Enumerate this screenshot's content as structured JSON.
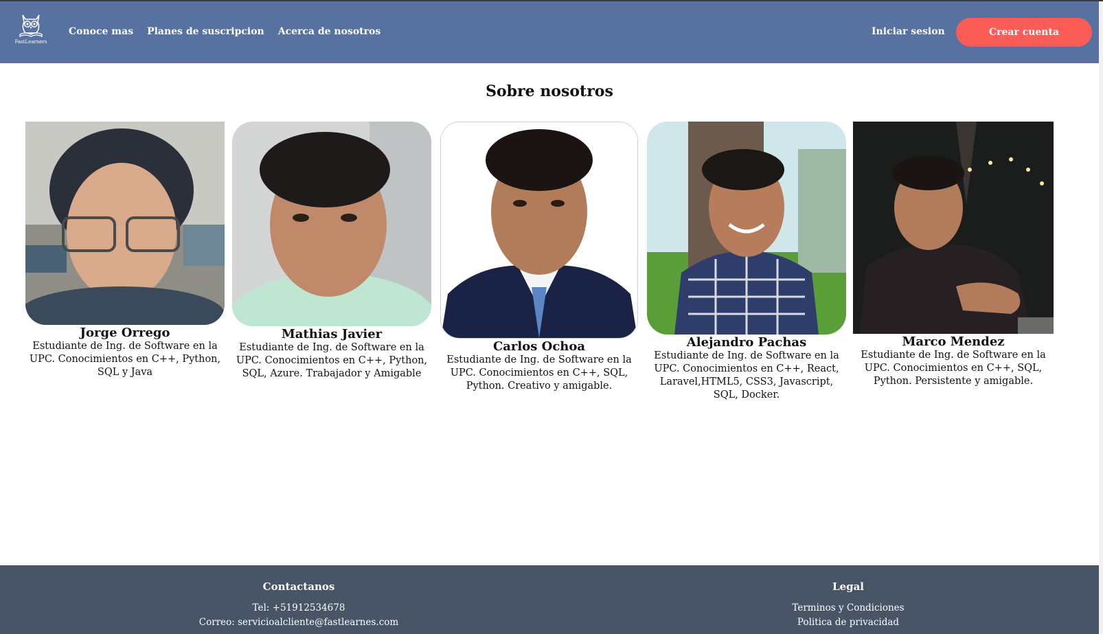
{
  "brand": {
    "name": "FastLearners"
  },
  "nav": {
    "links": [
      "Conoce mas",
      "Planes de suscripcion",
      "Acerca de nosotros"
    ],
    "login": "Iniciar sesion",
    "signup": "Crear cuenta"
  },
  "main": {
    "title": "Sobre nosotros",
    "members": [
      {
        "name": "Jorge Orrego",
        "description": "Estudiante de Ing. de Software en la UPC. Conocimientos en C++, Python, SQL y Java"
      },
      {
        "name": "Mathias Javier",
        "description": "Estudiante de Ing. de Software en la UPC. Conocimientos en C++, Python, SQL, Azure. Trabajador y Amigable"
      },
      {
        "name": "Carlos Ochoa",
        "description": "Estudiante de Ing. de Software en la UPC. Conocimientos en C++, SQL, Python. Creativo y amigable."
      },
      {
        "name": "Alejandro Pachas",
        "description": "Estudiante de Ing. de Software en la UPC. Conocimientos en C++, React, Laravel,HTML5, CSS3, Javascript, SQL, Docker."
      },
      {
        "name": "Marco Mendez",
        "description": "Estudiante de Ing. de Software en la UPC. Conocimientos en C++, SQL, Python. Persistente y amigable."
      }
    ]
  },
  "footer": {
    "contact": {
      "heading": "Contactanos",
      "phone": "Tel: +51912534678",
      "email": "Correo: servicioalcliente@fastlearnes.com"
    },
    "legal": {
      "heading": "Legal",
      "terms": "Terminos y Condiciones",
      "privacy": "Politica de privacidad"
    }
  },
  "colors": {
    "navbar": "#5772a0",
    "accent": "#fb5c57",
    "footer": "#475567"
  }
}
